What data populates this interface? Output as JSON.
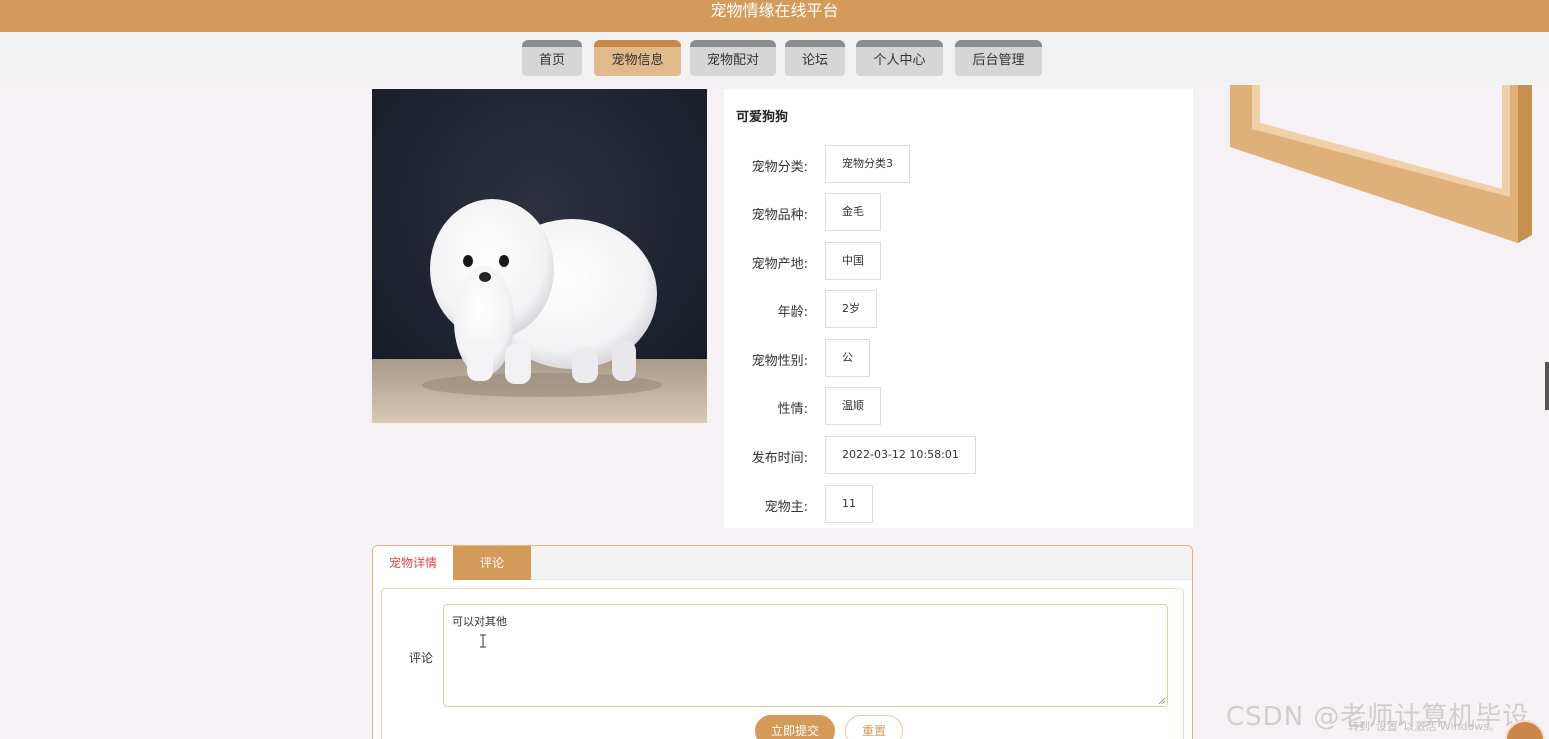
{
  "header": {
    "title": "宠物情缘在线平台"
  },
  "nav": {
    "items": [
      {
        "label": "首页"
      },
      {
        "label": "宠物信息"
      },
      {
        "label": "宠物配对"
      },
      {
        "label": "论坛"
      },
      {
        "label": "个人中心"
      },
      {
        "label": "后台管理"
      }
    ],
    "active_index": 1
  },
  "pet": {
    "name": "可爱狗狗",
    "fields": [
      {
        "label": "宠物分类:",
        "value": "宠物分类3"
      },
      {
        "label": "宠物品种:",
        "value": "金毛"
      },
      {
        "label": "宠物产地:",
        "value": "中国"
      },
      {
        "label": "年龄:",
        "value": "2岁"
      },
      {
        "label": "宠物性别:",
        "value": "公"
      },
      {
        "label": "性情:",
        "value": "温顺"
      },
      {
        "label": "发布时间:",
        "value": "2022-03-12 10:58:01"
      },
      {
        "label": "宠物主:",
        "value": "11"
      }
    ]
  },
  "tabs": {
    "detail_label": "宠物详情",
    "comment_label": "评论"
  },
  "comment_form": {
    "label": "评论",
    "value": "可以对其他",
    "submit_label": "立即提交",
    "reset_label": "重置"
  },
  "overlay": {
    "watermark": "CSDN @老师计算机毕设",
    "activate_windows": "转到“设置”以激活 Windows。"
  },
  "colors": {
    "accent": "#d39a5a",
    "active_tab_text": "#e04545"
  }
}
